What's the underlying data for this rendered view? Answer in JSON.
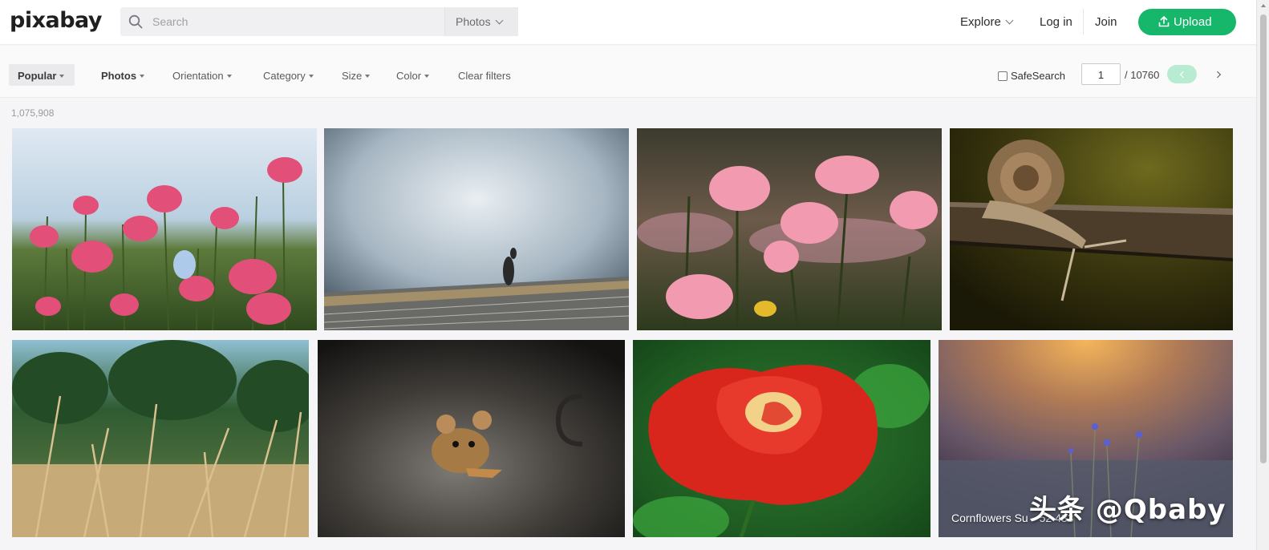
{
  "header": {
    "logo": "pixabay",
    "search_placeholder": "Search",
    "search_type": "Photos",
    "explore": "Explore",
    "login": "Log in",
    "join": "Join",
    "upload": "Upload"
  },
  "filters": {
    "popular": "Popular",
    "photos": "Photos",
    "orientation": "Orientation",
    "category": "Category",
    "size": "Size",
    "color": "Color",
    "clear": "Clear filters",
    "safesearch": "SafeSearch",
    "page": "1",
    "total_pages": "/ 10760"
  },
  "result_count": "1,075,908",
  "photos": [
    {
      "name": "pink-poppies-field"
    },
    {
      "name": "kangaroo-in-mist"
    },
    {
      "name": "pink-poppies-closeup"
    },
    {
      "name": "snail-on-wood"
    },
    {
      "name": "wheat-field"
    },
    {
      "name": "mouse-in-dark"
    },
    {
      "name": "red-rose"
    },
    {
      "name": "cornflowers-sunset",
      "caption": "Cornflowers",
      "caption2": "Su",
      "stats": "52   433"
    }
  ],
  "watermark": "头条 @Qbaby"
}
